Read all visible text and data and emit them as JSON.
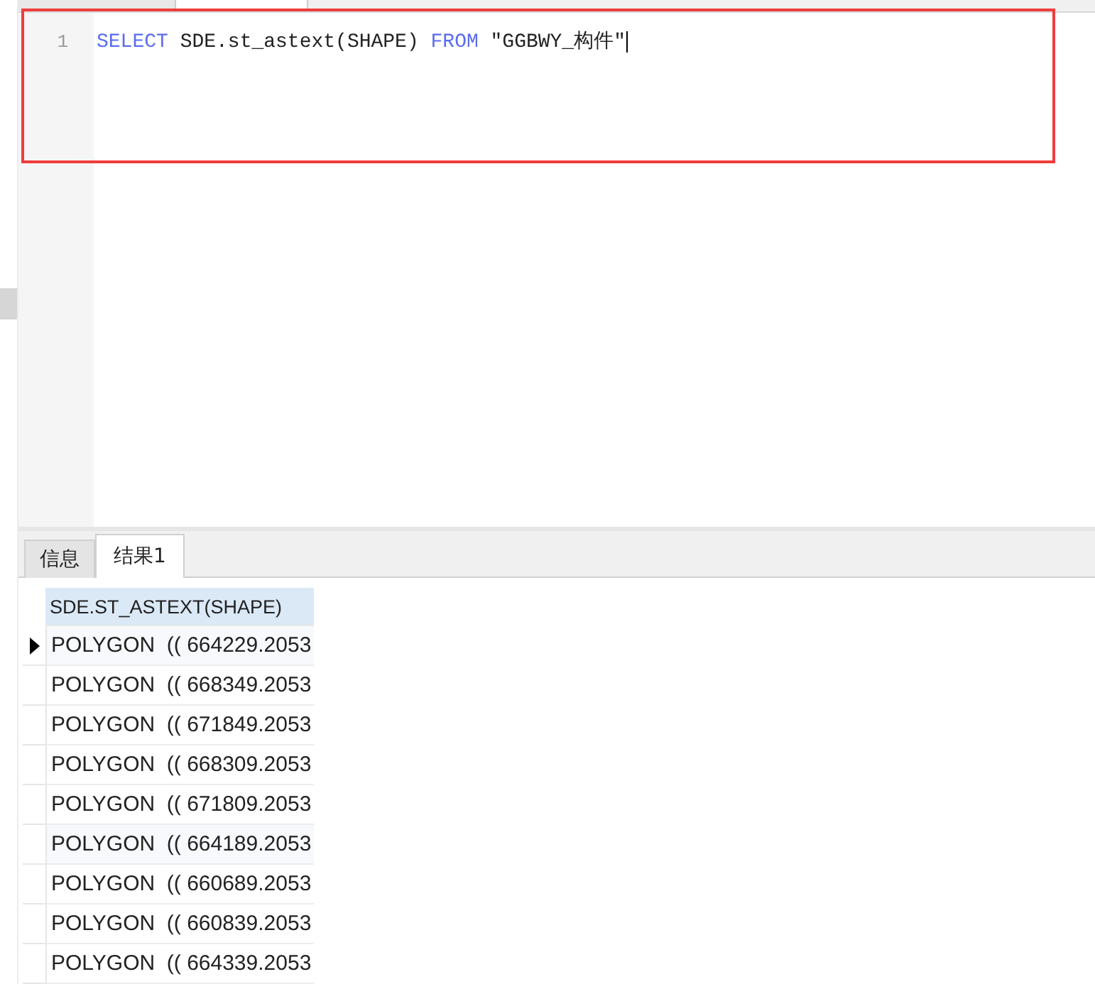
{
  "editor": {
    "lines": [
      {
        "number": "1",
        "tokens": [
          {
            "kind": "keyword",
            "text": "SELECT"
          },
          {
            "kind": "plain",
            "text": " SDE.st_astext(SHAPE) "
          },
          {
            "kind": "keyword",
            "text": "FROM"
          },
          {
            "kind": "plain",
            "text": " \"GGBWY_构件\""
          }
        ]
      }
    ]
  },
  "result_tabs": [
    {
      "label": "信息",
      "selected": false
    },
    {
      "label": "结果1",
      "selected": true
    }
  ],
  "table": {
    "columns": [
      "SDE.ST_ASTEXT(SHAPE)"
    ],
    "rows": [
      {
        "cells": [
          "POLYGON  (( 664229.2053"
        ],
        "current": true
      },
      {
        "cells": [
          "POLYGON  (( 668349.2053"
        ],
        "current": false
      },
      {
        "cells": [
          "POLYGON  (( 671849.2053"
        ],
        "current": false
      },
      {
        "cells": [
          "POLYGON  (( 668309.2053"
        ],
        "current": false
      },
      {
        "cells": [
          "POLYGON  (( 671809.2053"
        ],
        "current": false
      },
      {
        "cells": [
          "POLYGON  (( 664189.2053"
        ],
        "current": false
      },
      {
        "cells": [
          "POLYGON  (( 660689.2053"
        ],
        "current": false
      },
      {
        "cells": [
          "POLYGON  (( 660839.2053"
        ],
        "current": false
      },
      {
        "cells": [
          "POLYGON  (( 664339.2053"
        ],
        "current": false
      }
    ]
  }
}
